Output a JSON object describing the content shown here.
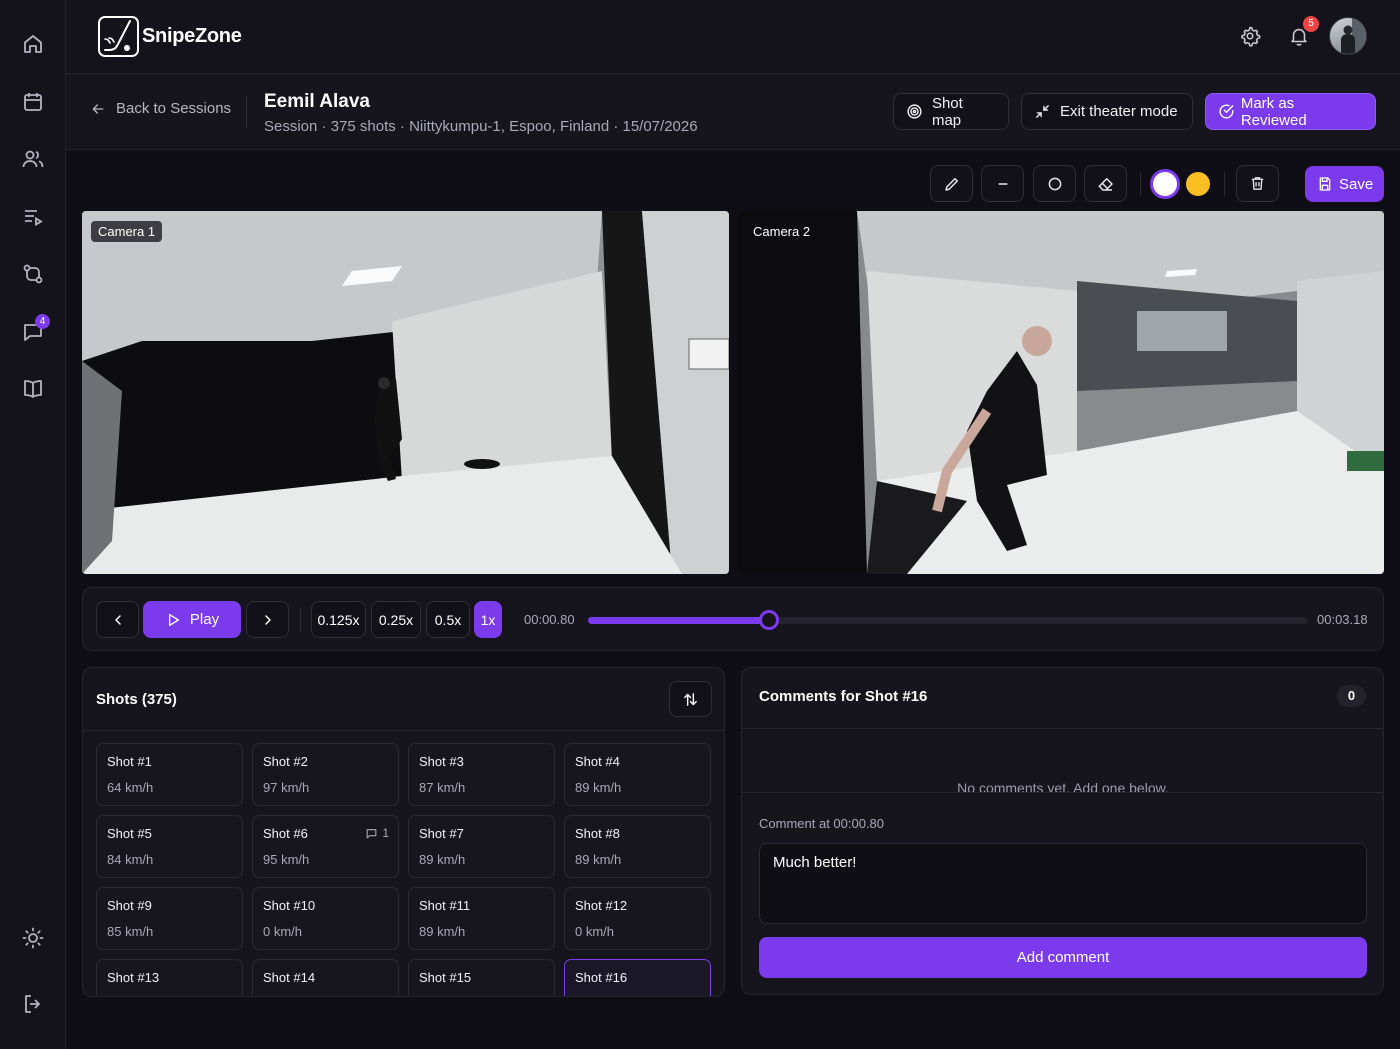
{
  "app": {
    "name": "SnipeZone",
    "notification_count": "5",
    "messages_badge": "4"
  },
  "header": {
    "back_label": "Back to Sessions",
    "title": "Eemil Alava",
    "subtitle": "Session · 375 shots · Niittykumpu-1, Espoo, Finland · 15/07/2026",
    "shot_map_label": "Shot map",
    "exit_theater_label": "Exit theater mode",
    "mark_reviewed_label": "Mark as Reviewed"
  },
  "toolbar": {
    "save_label": "Save",
    "colors": [
      "#ffffff",
      "#fbbf24"
    ],
    "accent": "#7c3aed"
  },
  "cameras": [
    {
      "label": "Camera 1"
    },
    {
      "label": "Camera 2"
    }
  ],
  "playback": {
    "play_label": "Play",
    "speeds": [
      "0.125x",
      "0.25x",
      "0.5x",
      "1x"
    ],
    "active_speed": "1x",
    "current_time": "00:00.80",
    "duration": "00:03.18",
    "progress": 0.2516
  },
  "shots": {
    "title": "Shots (375)",
    "items": [
      {
        "name": "Shot #1",
        "speed": "64 km/h"
      },
      {
        "name": "Shot #2",
        "speed": "97 km/h"
      },
      {
        "name": "Shot #3",
        "speed": "87 km/h"
      },
      {
        "name": "Shot #4",
        "speed": "89 km/h"
      },
      {
        "name": "Shot #5",
        "speed": "84 km/h"
      },
      {
        "name": "Shot #6",
        "speed": "95 km/h",
        "comments": "1"
      },
      {
        "name": "Shot #7",
        "speed": "89 km/h"
      },
      {
        "name": "Shot #8",
        "speed": "89 km/h"
      },
      {
        "name": "Shot #9",
        "speed": "85 km/h"
      },
      {
        "name": "Shot #10",
        "speed": "0 km/h"
      },
      {
        "name": "Shot #11",
        "speed": "89 km/h"
      },
      {
        "name": "Shot #12",
        "speed": "0 km/h"
      },
      {
        "name": "Shot #13",
        "speed": ""
      },
      {
        "name": "Shot #14",
        "speed": ""
      },
      {
        "name": "Shot #15",
        "speed": ""
      },
      {
        "name": "Shot #16",
        "speed": "",
        "selected": true
      }
    ]
  },
  "comments": {
    "title": "Comments for Shot #16",
    "count": "0",
    "empty_text": "No comments yet. Add one below.",
    "comment_at_label": "Comment at 00:00.80",
    "input_value": "Much better!",
    "add_button_label": "Add comment"
  }
}
